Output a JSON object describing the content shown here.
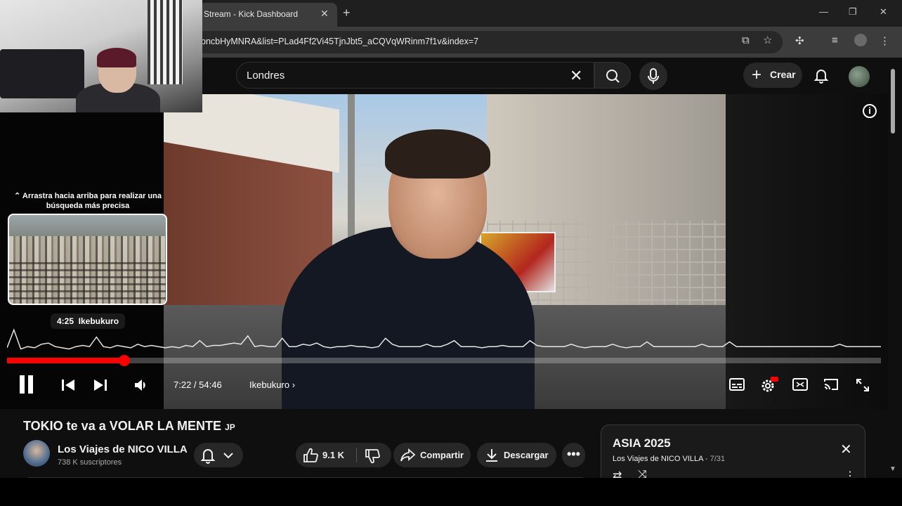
{
  "browser": {
    "tab_title": "Stream - Kick Dashboard",
    "url": "bncbHyMNRA&list=PLad4Ff2Vi45TjnJbt5_aCQVqWRinm7f1v&index=7"
  },
  "youtube": {
    "search_value": "Londres",
    "create_label": "Crear"
  },
  "player": {
    "seek_hint": "Arrastra hacia arriba para realizar una búsqueda más precisa",
    "seek_preview_time": "4:25",
    "seek_preview_chapter": "Ikebukuro",
    "current_time": "7:22",
    "duration": "54:46",
    "time_separator": " / ",
    "chapter": "Ikebukuro",
    "progress_fraction": 0.1345,
    "heat_values": [
      0.15,
      0.9,
      0.1,
      0.2,
      0.15,
      0.3,
      0.35,
      0.2,
      0.15,
      0.1,
      0.2,
      0.25,
      0.2,
      0.6,
      0.2,
      0.15,
      0.25,
      0.2,
      0.15,
      0.3,
      0.2,
      0.25,
      0.2,
      0.15,
      0.2,
      0.15,
      0.25,
      0.2,
      0.45,
      0.2,
      0.25,
      0.25,
      0.3,
      0.35,
      0.3,
      0.65,
      0.2,
      0.25,
      0.2,
      0.2,
      0.55,
      0.2,
      0.2,
      0.3,
      0.25,
      0.35,
      0.2,
      0.15,
      0.2,
      0.2,
      0.25,
      0.2,
      0.2,
      0.15,
      0.2,
      0.55,
      0.3,
      0.2,
      0.2,
      0.2,
      0.2,
      0.3,
      0.2,
      0.2,
      0.3,
      0.45,
      0.2,
      0.2,
      0.2,
      0.15,
      0.2,
      0.2,
      0.25,
      0.2,
      0.2,
      0.2,
      0.45,
      0.25,
      0.2,
      0.2,
      0.2,
      0.2,
      0.3,
      0.2,
      0.15,
      0.2,
      0.2,
      0.2,
      0.3,
      0.2,
      0.15,
      0.2,
      0.2,
      0.4,
      0.2,
      0.2,
      0.2,
      0.2,
      0.2,
      0.2,
      0.2,
      0.3,
      0.2,
      0.2,
      0.2,
      0.4,
      0.2,
      0.2,
      0.2,
      0.2,
      0.2,
      0.2,
      0.2,
      0.2,
      0.2,
      0.2,
      0.2,
      0.2,
      0.2,
      0.2,
      0.2,
      0.3,
      0.2,
      0.2,
      0.2,
      0.2,
      0.2,
      0.2
    ]
  },
  "video": {
    "title": "TOKIO te va a VOLAR LA MENTE",
    "flag": "JP",
    "channel": "Los Viajes de NICO VILLA",
    "subscribers": "738 K suscriptores",
    "likes": "9.1 K",
    "share_label": "Compartir",
    "download_label": "Descargar"
  },
  "playlist": {
    "title": "ASIA 2025",
    "channel": "Los Viajes de NICO VILLA",
    "separator": " - ",
    "position": "7/31"
  },
  "colors": {
    "accent_red": "#ff0000",
    "background": "#0f0f0f",
    "pill_bg": "#272727"
  }
}
